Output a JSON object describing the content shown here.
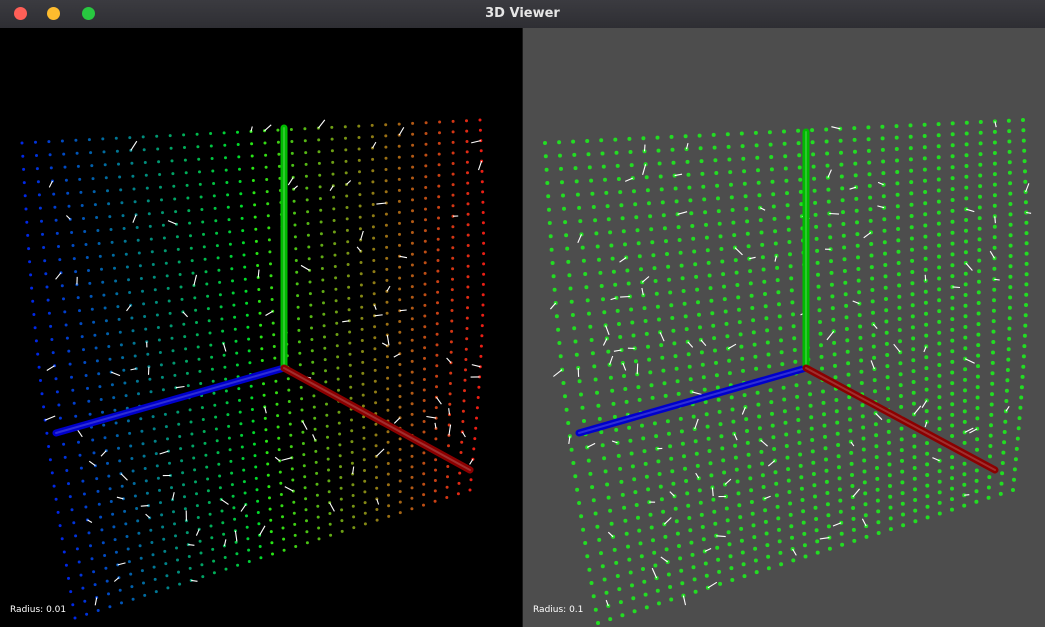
{
  "window": {
    "title": "3D Viewer"
  },
  "viewports": [
    {
      "radius_label": "Radius: 0.01",
      "background": "#000000",
      "point_coloring": "height-colormap (blue-green-red)"
    },
    {
      "radius_label": "Radius: 0.1",
      "background": "#4d4d4d",
      "point_coloring": "uniform green",
      "point_color": "#22dd22"
    }
  ],
  "axes": {
    "x_color": "#8b0000",
    "y_color": "#00bb00",
    "z_color": "#0000cc"
  },
  "normal_color": "#ffffff"
}
